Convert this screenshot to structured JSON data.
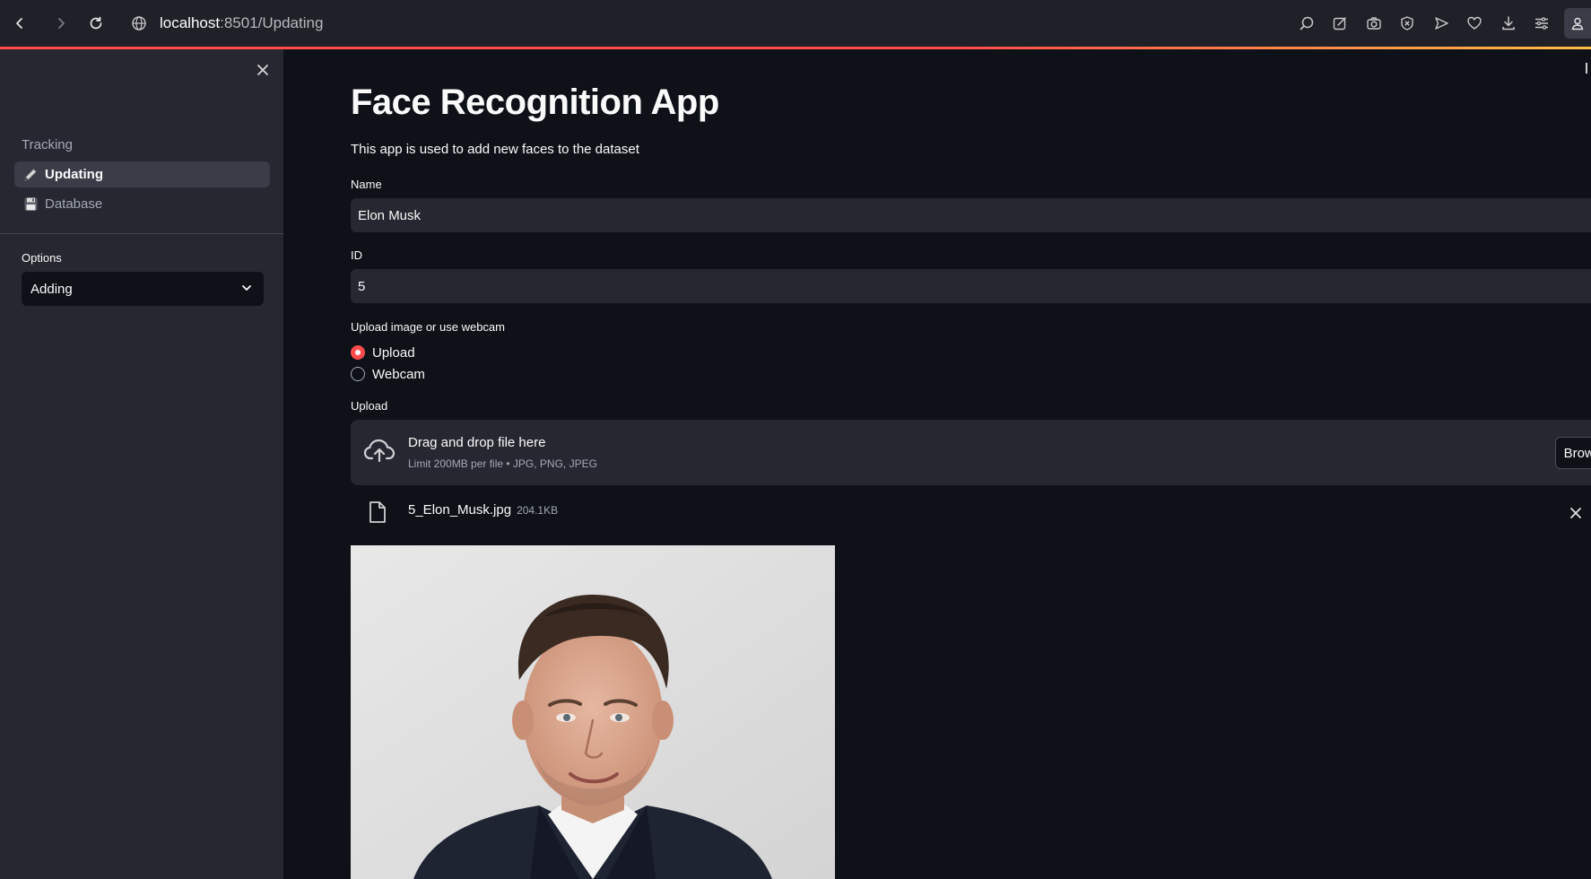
{
  "browser": {
    "url_host": "localhost",
    "url_path": ":8501/Updating"
  },
  "sidebar": {
    "nav_items": [
      {
        "label": "Tracking",
        "icon": "",
        "active": false
      },
      {
        "label": "Updating",
        "icon": "pencil-icon",
        "active": true
      },
      {
        "label": "Database",
        "icon": "floppy-disk-icon",
        "active": false
      }
    ],
    "options_label": "Options",
    "options_value": "Adding"
  },
  "main": {
    "title": "Face Recognition App",
    "description": "This app is used to add new faces to the dataset",
    "name_label": "Name",
    "name_value": "Elon Musk",
    "id_label": "ID",
    "id_value": "5",
    "source_label": "Upload image or use webcam",
    "source_options": [
      {
        "label": "Upload",
        "selected": true
      },
      {
        "label": "Webcam",
        "selected": false
      }
    ],
    "upload_label": "Upload",
    "dropzone_title": "Drag and drop file here",
    "dropzone_sub": "Limit 200MB per file • JPG, PNG, JPEG",
    "browse_label": "Browse files",
    "file_name": "5_Elon_Musk.jpg",
    "file_size": "204.1KB"
  },
  "colors": {
    "accent": "#ff4b4b",
    "sidebar_bg": "#262730",
    "main_bg": "#0e1117"
  }
}
